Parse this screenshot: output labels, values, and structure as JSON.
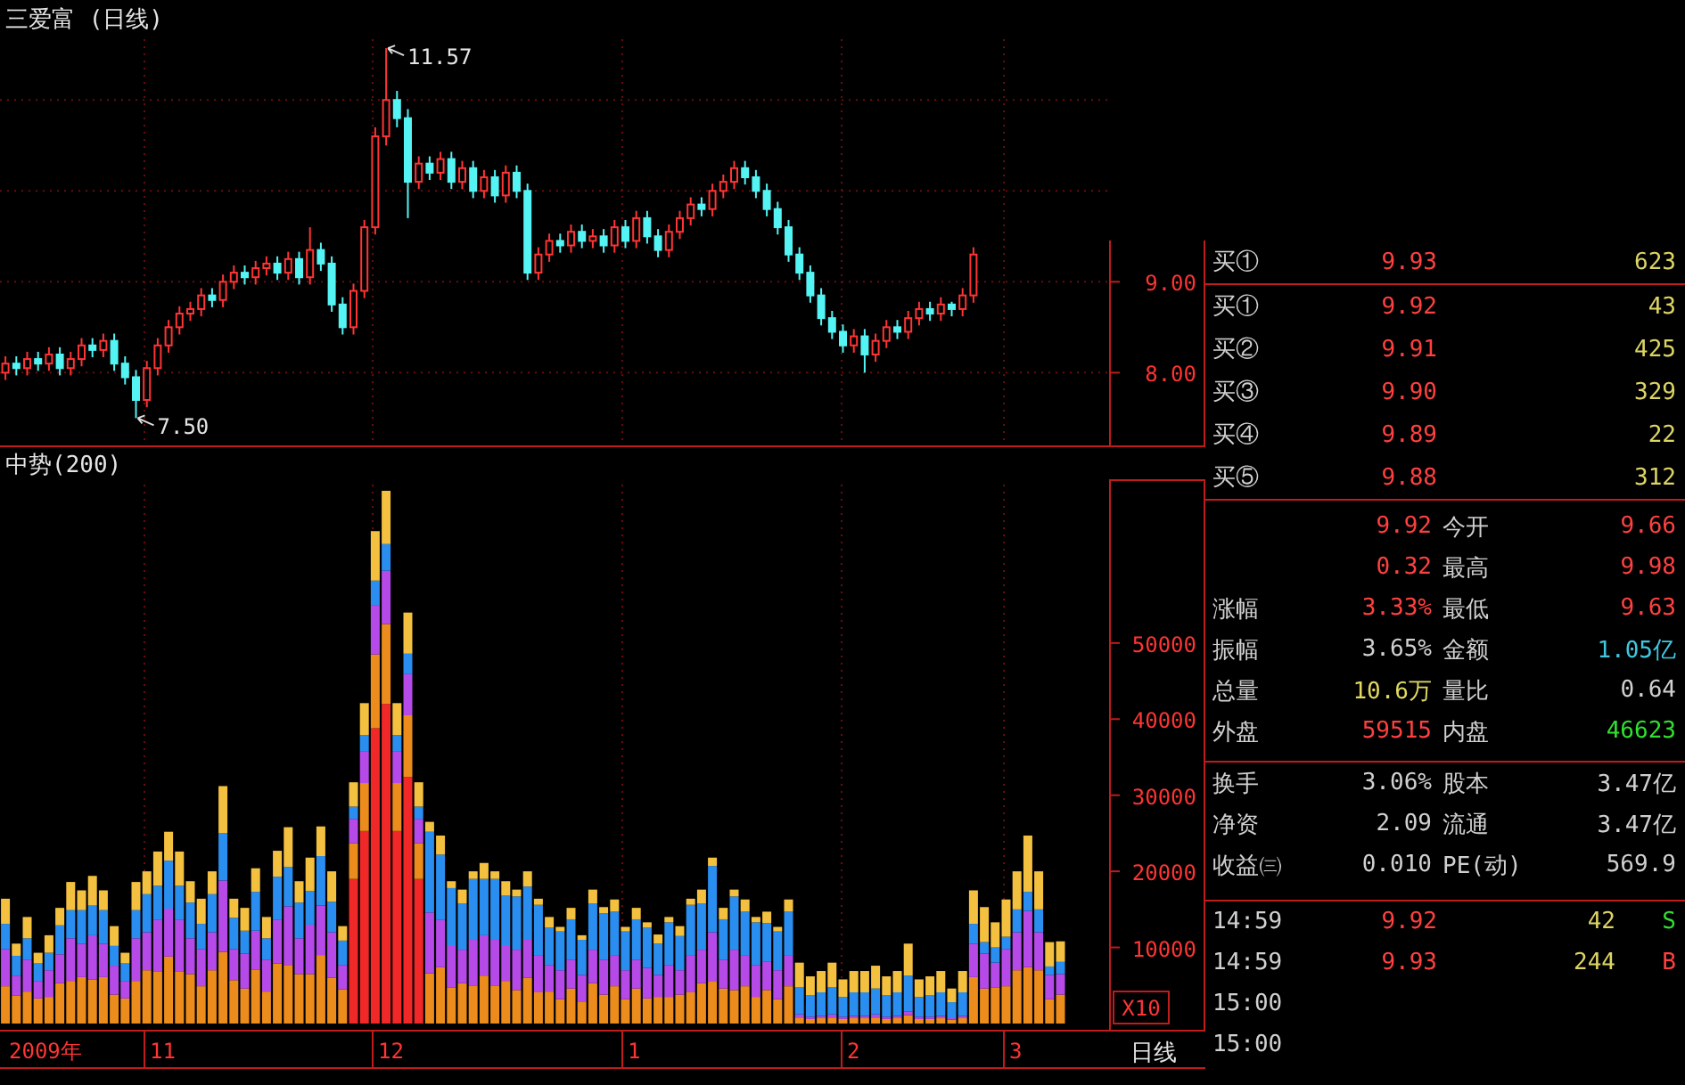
{
  "price_chart": {
    "title": "三爱富 (日线)",
    "axis_labels": [
      "9.00",
      "8.00"
    ],
    "callouts": [
      "11.57",
      "7.50"
    ]
  },
  "indicator_chart": {
    "chart_data": {
      "type": "bar",
      "stacked": true,
      "title": "中势(200)",
      "ylim": [
        0,
        71400
      ],
      "yticks": [
        10000,
        20000,
        30000,
        40000,
        50000
      ],
      "series": [
        {
          "color": "#f02828",
          "values": [
            0,
            0,
            0,
            0,
            0,
            0,
            0,
            0,
            0,
            0,
            0,
            0,
            0,
            0,
            0,
            0,
            0,
            0,
            0,
            0,
            0,
            0,
            0,
            0,
            0,
            0,
            0,
            0,
            0,
            0,
            0,
            0,
            19000,
            25300,
            38800,
            42000,
            25300,
            32400,
            19000,
            0,
            0,
            0,
            0,
            0,
            0,
            0,
            0,
            0,
            0,
            0,
            0,
            0,
            0,
            0,
            0,
            0,
            0,
            0,
            0,
            0,
            0,
            0,
            0,
            0,
            0,
            0,
            0,
            0,
            0,
            0,
            0,
            0,
            0,
            0,
            0,
            0,
            0,
            0,
            0,
            0,
            0,
            0,
            0,
            0,
            0,
            0,
            0,
            0,
            0,
            0,
            0,
            0,
            0,
            0,
            0,
            0,
            0,
            0
          ]
        },
        {
          "color": "#ec8c1c",
          "values": [
            4900,
            3700,
            4200,
            3300,
            3500,
            5300,
            5600,
            6100,
            5800,
            6100,
            3800,
            3300,
            5600,
            7000,
            6800,
            8800,
            6800,
            6500,
            4900,
            7000,
            9400,
            5700,
            4600,
            7100,
            4200,
            7900,
            7700,
            6500,
            6500,
            9000,
            6000,
            4500,
            4700,
            6300,
            9700,
            10500,
            6300,
            8100,
            4700,
            6600,
            7400,
            4700,
            5300,
            5000,
            6300,
            5000,
            5600,
            4400,
            6000,
            4100,
            4200,
            3200,
            4600,
            2900,
            5300,
            3800,
            4900,
            3200,
            4600,
            3300,
            3500,
            3500,
            3800,
            4100,
            5300,
            5500,
            4600,
            4400,
            4900,
            3500,
            4400,
            3200,
            4900,
            800,
            600,
            700,
            800,
            600,
            700,
            700,
            800,
            600,
            700,
            1100,
            600,
            600,
            700,
            500,
            700,
            6100,
            4600,
            4700,
            4900,
            7000,
            7400,
            7000,
            3200,
            3800
          ]
        },
        {
          "color": "#b64ae8",
          "values": [
            4900,
            2600,
            4200,
            2300,
            3500,
            3800,
            5600,
            4400,
            5800,
            4400,
            3800,
            2300,
            5600,
            5000,
            6800,
            6300,
            6800,
            4700,
            4900,
            5000,
            9400,
            4100,
            4600,
            5100,
            4200,
            5700,
            7700,
            4700,
            6500,
            6500,
            6000,
            3200,
            3200,
            4200,
            6500,
            7000,
            4200,
            5400,
            3200,
            8000,
            6200,
            5600,
            4400,
            6000,
            5300,
            6000,
            4700,
            5300,
            5000,
            4900,
            3500,
            3800,
            3800,
            3500,
            4400,
            4600,
            4100,
            3800,
            3800,
            4000,
            2900,
            4200,
            3200,
            4900,
            4400,
            6500,
            3800,
            5300,
            4100,
            4200,
            3700,
            3800,
            4100,
            400,
            300,
            300,
            400,
            300,
            300,
            300,
            400,
            300,
            300,
            500,
            300,
            300,
            300,
            200,
            300,
            4400,
            4600,
            3300,
            4900,
            5000,
            7400,
            5000,
            3200,
            2700
          ]
        },
        {
          "color": "#2a8ef0",
          "values": [
            3300,
            2600,
            2800,
            2300,
            2300,
            3800,
            3700,
            4400,
            3900,
            4400,
            2600,
            2300,
            3700,
            5000,
            4500,
            6300,
            4500,
            4700,
            3300,
            5000,
            6200,
            4100,
            3000,
            5100,
            2800,
            5700,
            5200,
            4700,
            4400,
            6500,
            4000,
            3200,
            1600,
            2100,
            3200,
            3500,
            2100,
            2700,
            1600,
            10600,
            8600,
            7500,
            6100,
            8000,
            7400,
            8000,
            6500,
            7000,
            7000,
            6600,
            4900,
            5100,
            5300,
            4600,
            6100,
            6100,
            5700,
            5100,
            5300,
            5300,
            4100,
            5600,
            4500,
            6600,
            6100,
            8700,
            5300,
            7000,
            5700,
            5600,
            5100,
            5100,
            5700,
            3600,
            2800,
            3100,
            3600,
            2600,
            3100,
            3100,
            3400,
            2800,
            3100,
            4700,
            2600,
            2800,
            3100,
            2100,
            3100,
            2600,
            1500,
            2000,
            1600,
            3000,
            2500,
            3000,
            1100,
            1600
          ]
        },
        {
          "color": "#f4c040",
          "values": [
            3300,
            1600,
            2800,
            1400,
            2300,
            2300,
            3700,
            2600,
            3900,
            2600,
            2600,
            1400,
            3700,
            3000,
            4500,
            3800,
            4500,
            2800,
            3300,
            3000,
            6200,
            2500,
            3000,
            3100,
            2800,
            3400,
            5200,
            2800,
            4400,
            3900,
            4000,
            1900,
            3200,
            4200,
            6500,
            7000,
            4200,
            5400,
            3200,
            1300,
            2500,
            900,
            1800,
            1000,
            2100,
            1000,
            1900,
            900,
            2000,
            800,
            1400,
            600,
            1500,
            600,
            1800,
            800,
            1600,
            600,
            1500,
            700,
            1200,
            700,
            1300,
            800,
            1800,
            1100,
            1500,
            900,
            1600,
            700,
            1500,
            600,
            1600,
            3200,
            2500,
            2800,
            3200,
            2300,
            2800,
            2800,
            3000,
            2500,
            2800,
            4200,
            2300,
            2500,
            2800,
            1800,
            2800,
            4400,
            4600,
            3300,
            4900,
            5000,
            7400,
            5000,
            3200,
            2700
          ]
        }
      ]
    },
    "scale_label": "X10"
  },
  "date_axis": {
    "labels": [
      "2009年",
      "11",
      "12",
      "1",
      "2",
      "3"
    ],
    "period_label": "日线"
  },
  "asks": [
    {
      "label": "买①",
      "price": "9.93",
      "volume": "623"
    }
  ],
  "bids": [
    {
      "label": "买①",
      "price": "9.92",
      "volume": "43"
    },
    {
      "label": "买②",
      "price": "9.91",
      "volume": "425"
    },
    {
      "label": "买③",
      "price": "9.90",
      "volume": "329"
    },
    {
      "label": "买④",
      "price": "9.89",
      "volume": "22"
    },
    {
      "label": "买⑤",
      "price": "9.88",
      "volume": "312"
    }
  ],
  "quote_stats": [
    {
      "left": {
        "value": "9.92",
        "color": "#ff4040"
      },
      "right": {
        "label": "今开",
        "value": "9.66",
        "color": "#ff4040"
      }
    },
    {
      "left": {
        "value": "0.32",
        "color": "#ff4040"
      },
      "right": {
        "label": "最高",
        "value": "9.98",
        "color": "#ff4040"
      }
    },
    {
      "left": {
        "label": "涨幅",
        "value": "3.33%",
        "color": "#ff4040"
      },
      "right": {
        "label": "最低",
        "value": "9.63",
        "color": "#ff4040"
      }
    },
    {
      "left": {
        "label": "振幅",
        "value": "3.65%",
        "color": "#d0d0d0"
      },
      "right": {
        "label": "金额",
        "value": "1.05亿",
        "color": "#40c8e0"
      }
    },
    {
      "left": {
        "label": "总量",
        "value": "10.6万",
        "color": "#e0d860"
      },
      "right": {
        "label": "量比",
        "value": "0.64",
        "color": "#d0d0d0"
      }
    },
    {
      "left": {
        "label": "外盘",
        "value": "59515",
        "color": "#ff4040"
      },
      "right": {
        "label": "内盘",
        "value": "46623",
        "color": "#30e030"
      }
    }
  ],
  "share_stats": [
    {
      "left": {
        "label": "换手",
        "value": "3.06%",
        "color": "#d0d0d0"
      },
      "right": {
        "label": "股本",
        "value": "3.47亿",
        "color": "#d0d0d0"
      }
    },
    {
      "left": {
        "label": "净资",
        "value": "2.09",
        "color": "#d0d0d0"
      },
      "right": {
        "label": "流通",
        "value": "3.47亿",
        "color": "#d0d0d0"
      }
    },
    {
      "left": {
        "label": "收益㈢",
        "value": "0.010",
        "color": "#d0d0d0"
      },
      "right": {
        "label": "PE(动)",
        "value": "569.9",
        "color": "#d0d0d0"
      }
    }
  ],
  "trades": [
    {
      "time": "14:59",
      "price": "9.92",
      "volume": "42",
      "side": "S",
      "color": "#30e030"
    },
    {
      "time": "14:59",
      "price": "9.93",
      "volume": "244",
      "side": "B",
      "color": "#ff4040"
    },
    {
      "time": "15:00"
    },
    {
      "time": "15:00"
    }
  ]
}
